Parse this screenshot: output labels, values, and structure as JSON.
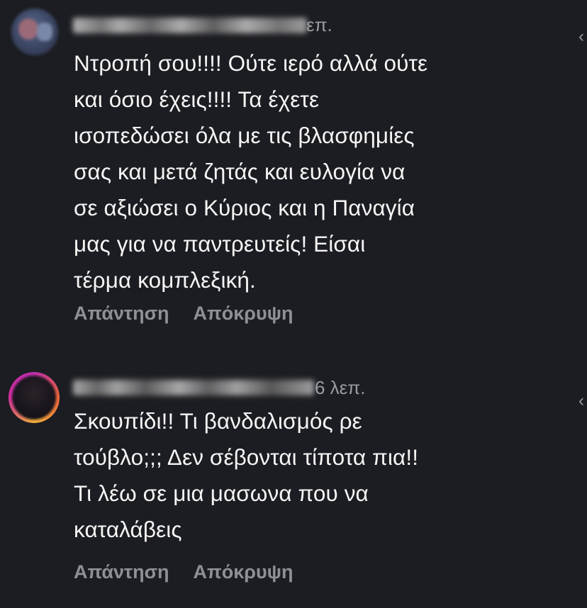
{
  "comments": [
    {
      "time": "επ.",
      "text": "Ντροπή σου!!!! Ούτε ιερό αλλά ούτε\nκαι όσιο έχεις!!!! Τα έχετε\nισοπεδώσει όλα με τις βλασφημίες\nσας και μετά ζητάς και ευλογία να\nσε αξιώσει ο Κύριος και η Παναγία\nμας για να παντρευτείς! Είσαι\nτέρμα κομπλεξική.",
      "reply_label": "Απάντηση",
      "hide_label": "Απόκρυψη"
    },
    {
      "time": "6 λεπ.",
      "text": "Σκουπίδι!! Τι βανδαλισμός ρε\nτούβλο;;; Δεν σέβονται τίποτα πια!!\nΤι λέω σε μια μασωνα που να\nκαταλάβεις",
      "reply_label": "Απάντηση",
      "hide_label": "Απόκρυψη"
    }
  ],
  "colors": {
    "background": "#1c1d22",
    "text": "#f5f5f5",
    "muted": "#8f9095"
  },
  "icons": {
    "edge_control": "chevron-left-icon"
  }
}
